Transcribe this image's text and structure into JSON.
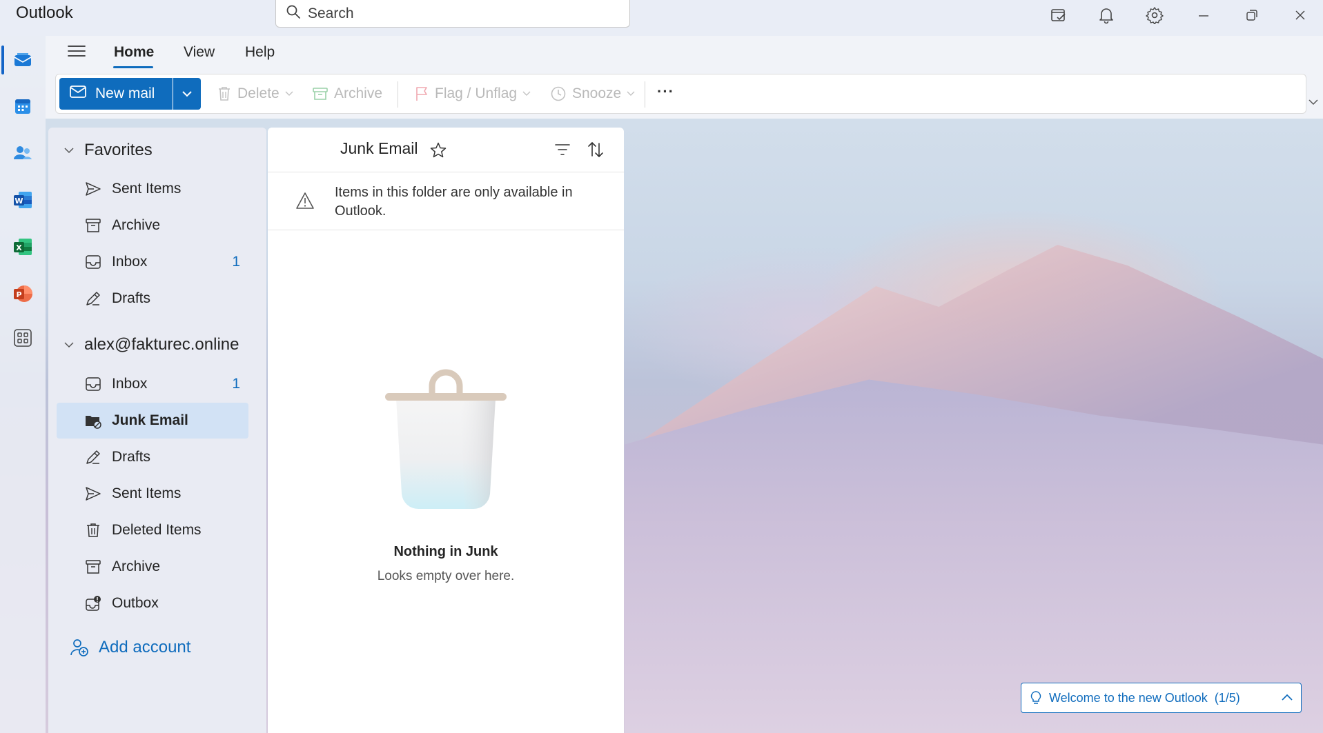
{
  "app": {
    "title": "Outlook"
  },
  "search": {
    "placeholder": "Search"
  },
  "ribbon": {
    "tabs": [
      "Home",
      "View",
      "Help"
    ],
    "new_mail": "New mail",
    "delete": "Delete",
    "archive": "Archive",
    "flag": "Flag / Unflag",
    "snooze": "Snooze",
    "more": "···"
  },
  "folders": {
    "favorites_label": "Favorites",
    "favorites": [
      {
        "label": "Sent Items"
      },
      {
        "label": "Archive"
      },
      {
        "label": "Inbox",
        "count": "1"
      },
      {
        "label": "Drafts"
      }
    ],
    "account_label": "alex@fakturec.online",
    "account": [
      {
        "label": "Inbox",
        "count": "1"
      },
      {
        "label": "Junk Email",
        "selected": true
      },
      {
        "label": "Drafts"
      },
      {
        "label": "Sent Items"
      },
      {
        "label": "Deleted Items"
      },
      {
        "label": "Archive"
      },
      {
        "label": "Outbox"
      }
    ],
    "add_account": "Add account"
  },
  "message_list": {
    "title": "Junk Email",
    "info": "Items in this folder are only available in Outlook.",
    "empty_title": "Nothing in Junk",
    "empty_subtitle": "Looks empty over here."
  },
  "welcome": {
    "text": "Welcome to the new Outlook",
    "progress": "(1/5)"
  },
  "colors": {
    "accent": "#0f6cbd",
    "selected_bg": "#d2e2f5"
  }
}
